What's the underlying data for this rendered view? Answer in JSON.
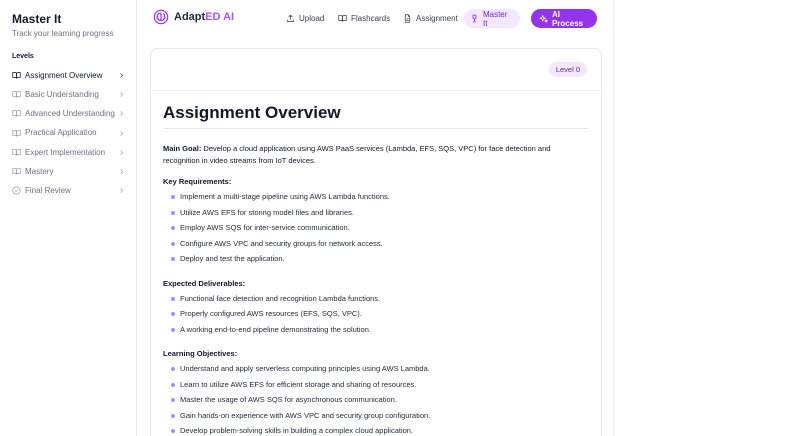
{
  "sidebar": {
    "title": "Master It",
    "subtitle": "Track your learning progress",
    "section_label": "Levels",
    "items": [
      {
        "label": "Assignment Overview",
        "icon": "book-icon",
        "active": true
      },
      {
        "label": "Basic Understanding",
        "icon": "book-icon",
        "active": false
      },
      {
        "label": "Advanced Understanding",
        "icon": "book-icon",
        "active": false
      },
      {
        "label": "Practical Application",
        "icon": "book-icon",
        "active": false
      },
      {
        "label": "Expert Implementation",
        "icon": "book-icon",
        "active": false
      },
      {
        "label": "Mastery",
        "icon": "book-icon",
        "active": false
      },
      {
        "label": "Final Review",
        "icon": "check-circle-icon",
        "active": false
      }
    ]
  },
  "header": {
    "logo_main": "Adapt",
    "logo_accent": "ED AI",
    "nav": [
      {
        "label": "Upload",
        "icon": "upload-icon"
      },
      {
        "label": "Flashcards",
        "icon": "book-open-icon"
      },
      {
        "label": "Assignment",
        "icon": "file-icon"
      },
      {
        "label": "Master It",
        "icon": "trophy-icon"
      }
    ],
    "primary_button": {
      "label": "AI Process",
      "icon": "sparkles-icon"
    }
  },
  "document": {
    "level_badge": "Level 0",
    "title": "Assignment Overview",
    "main_goal_label": "Main Goal:",
    "main_goal_text": " Develop a cloud application using AWS PaaS services (Lambda, EFS, SQS, VPC) for face detection and recognition in video streams from IoT devices.",
    "sections": [
      {
        "heading": "Key Requirements:",
        "items": [
          "Implement a multi-stage pipeline using AWS Lambda functions.",
          "Utilize AWS EFS for storing model files and libraries.",
          "Employ AWS SQS for inter-service communication.",
          "Configure AWS VPC and security groups for network access.",
          "Deploy and test the application."
        ]
      },
      {
        "heading": "Expected Deliverables:",
        "items": [
          "Functional face detection and recognition Lambda functions.",
          "Properly configured AWS resources (EFS, SQS, VPC).",
          "A working end-to-end pipeline demonstrating the solution."
        ]
      },
      {
        "heading": "Learning Objectives:",
        "items": [
          "Understand and apply serverless computing principles using AWS Lambda.",
          "Learn to utilize AWS EFS for efficient storage and sharing of resources.",
          "Master the usage of AWS SQS for asynchronous communication.",
          "Gain hands-on experience with AWS VPC and security group configuration.",
          "Develop problem-solving skills in building a complex cloud application."
        ]
      }
    ]
  },
  "colors": {
    "accent": "#9333ea",
    "accent_light": "#f3e8ff",
    "bullet": "#a78bfa"
  }
}
